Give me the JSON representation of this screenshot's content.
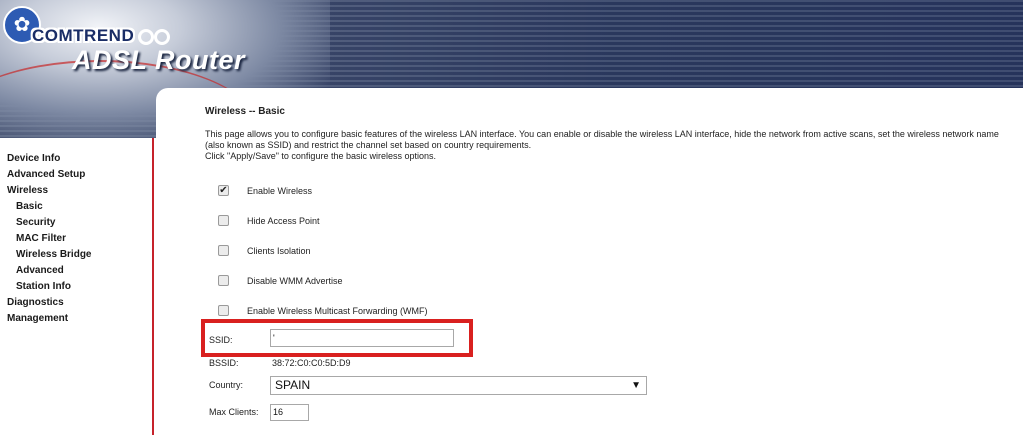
{
  "header": {
    "brand": "COMTREND",
    "product": "ADSL Router",
    "logo_icon": "flower-icon"
  },
  "sidebar": {
    "items": [
      {
        "label": "Device Info",
        "level": 0
      },
      {
        "label": "Advanced Setup",
        "level": 0
      },
      {
        "label": "Wireless",
        "level": 0
      },
      {
        "label": "Basic",
        "level": 1
      },
      {
        "label": "Security",
        "level": 1
      },
      {
        "label": "MAC Filter",
        "level": 1
      },
      {
        "label": "Wireless Bridge",
        "level": 1
      },
      {
        "label": "Advanced",
        "level": 1
      },
      {
        "label": "Station Info",
        "level": 1
      },
      {
        "label": "Diagnostics",
        "level": 0
      },
      {
        "label": "Management",
        "level": 0
      }
    ]
  },
  "main": {
    "title": "Wireless -- Basic",
    "description": "This page allows you to configure basic features of the wireless LAN interface. You can enable or disable the wireless LAN interface, hide the network from active scans, set the wireless network name (also known as SSID) and restrict the channel set based on country requirements.",
    "instruction": "Click \"Apply/Save\" to configure the basic wireless options.",
    "options": [
      {
        "label": "Enable Wireless",
        "checked": true
      },
      {
        "label": "Hide Access Point",
        "checked": false
      },
      {
        "label": "Clients Isolation",
        "checked": false
      },
      {
        "label": "Disable WMM Advertise",
        "checked": false
      },
      {
        "label": "Enable Wireless Multicast Forwarding (WMF)",
        "checked": false
      }
    ],
    "ssid": {
      "label": "SSID:",
      "value": "'"
    },
    "bssid": {
      "label": "BSSID:",
      "value": "38:72:C0:C0:5D:D9"
    },
    "country": {
      "label": "Country:",
      "value": "SPAIN"
    },
    "max_clients": {
      "label": "Max Clients:",
      "value": "16"
    },
    "highlight_color": "#d9201f"
  }
}
